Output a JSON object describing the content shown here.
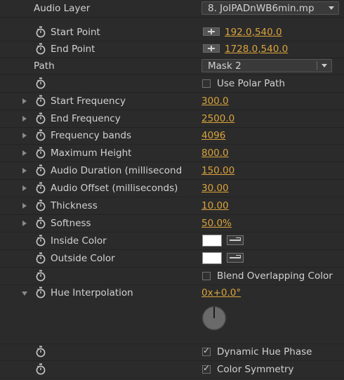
{
  "rows": {
    "audio_layer": {
      "label": "Audio Layer",
      "value": "8. JoIPADnWB6min.mp"
    },
    "start_point": {
      "label": "Start Point",
      "value": "192.0,540.0"
    },
    "end_point": {
      "label": "End Point",
      "value": "1728.0,540.0"
    },
    "path": {
      "label": "Path",
      "value": "Mask 2"
    },
    "use_polar_path": {
      "label": "Use Polar Path",
      "checked": false
    },
    "start_frequency": {
      "label": "Start Frequency",
      "value": "300.0"
    },
    "end_frequency": {
      "label": "End Frequency",
      "value": "2500.0"
    },
    "frequency_bands": {
      "label": "Frequency bands",
      "value": "4096"
    },
    "maximum_height": {
      "label": "Maximum Height",
      "value": "800.0"
    },
    "audio_duration": {
      "label": "Audio Duration (millisecond",
      "value": "150.00"
    },
    "audio_offset": {
      "label": "Audio Offset (milliseconds)",
      "value": "30.00"
    },
    "thickness": {
      "label": "Thickness",
      "value": "10.00"
    },
    "softness": {
      "label": "Softness",
      "value": "50.0%"
    },
    "inside_color": {
      "label": "Inside Color",
      "color": "#ffffff"
    },
    "outside_color": {
      "label": "Outside Color",
      "color": "#ffffff"
    },
    "blend_overlapping": {
      "label": "Blend Overlapping Color",
      "checked": false
    },
    "hue_interpolation": {
      "label": "Hue Interpolation",
      "value": "0x+0.0°",
      "angle_degrees": 0
    },
    "dynamic_hue_phase": {
      "label": "Dynamic Hue Phase",
      "checked": true
    },
    "color_symmetry": {
      "label": "Color Symmetry",
      "checked": true
    }
  },
  "icons": {
    "stopwatch": "stopwatch-icon",
    "twirl": "twirl-triangle-icon",
    "point_control": "crosshair-icon",
    "eyedropper": "eyedropper-icon",
    "dropdown_arrow": "chevron-down-icon"
  },
  "colors": {
    "panel_bg": "#2b2b2b",
    "text": "#d2d2d2",
    "value_accent": "#dba43c"
  }
}
